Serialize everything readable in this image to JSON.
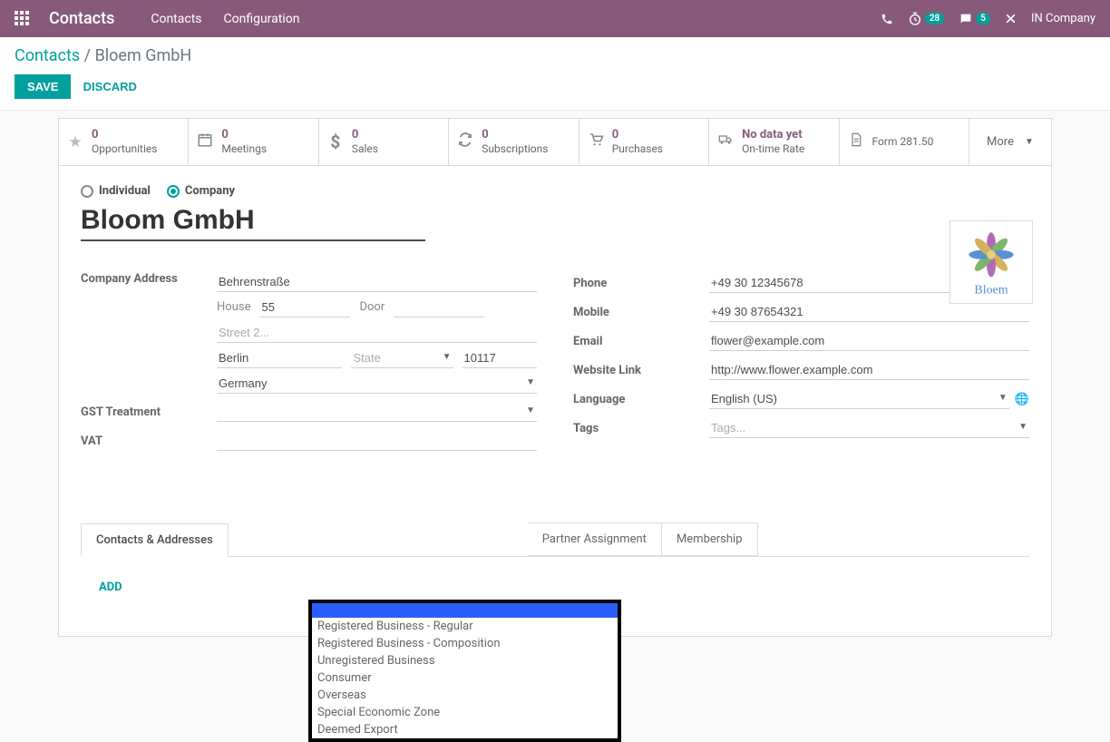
{
  "topbar": {
    "brand": "Contacts",
    "nav": {
      "contacts": "Contacts",
      "configuration": "Configuration"
    },
    "timer_badge": "28",
    "chat_badge": "5",
    "company": "IN Company"
  },
  "breadcrumb": {
    "root": "Contacts",
    "current": "Bloem GmbH"
  },
  "actions": {
    "save": "SAVE",
    "discard": "DISCARD"
  },
  "stats": {
    "opportunities": {
      "num": "0",
      "label": "Opportunities"
    },
    "meetings": {
      "num": "0",
      "label": "Meetings"
    },
    "sales": {
      "num": "0",
      "label": "Sales"
    },
    "subscriptions": {
      "num": "0",
      "label": "Subscriptions"
    },
    "purchases": {
      "num": "0",
      "label": "Purchases"
    },
    "ontime": {
      "num": "No data yet",
      "label": "On-time Rate"
    },
    "form281": "Form 281.50",
    "more": "More"
  },
  "type": {
    "individual": "Individual",
    "company": "Company"
  },
  "name": "Bloom GmbH",
  "avatar_caption": "Bloem",
  "labels": {
    "company_address": "Company Address",
    "gst": "GST Treatment",
    "vat": "VAT",
    "phone": "Phone",
    "mobile": "Mobile",
    "email": "Email",
    "website": "Website Link",
    "language": "Language",
    "tags": "Tags"
  },
  "address": {
    "street": "Behrenstraße",
    "house_label": "House",
    "house": "55",
    "door_label": "Door",
    "door": "",
    "street2_ph": "Street 2...",
    "city": "Berlin",
    "state_ph": "State",
    "zip": "10117",
    "country": "Germany"
  },
  "contact": {
    "phone": "+49 30 12345678",
    "mobile": "+49 30 87654321",
    "email": "flower@example.com",
    "website": "http://www.flower.example.com",
    "language": "English (US)",
    "tags_ph": "Tags..."
  },
  "gst_options": [
    "Registered Business - Regular",
    "Registered Business - Composition",
    "Unregistered Business",
    "Consumer",
    "Overseas",
    "Special Economic Zone",
    "Deemed Export"
  ],
  "tabs": {
    "contacts": "Contacts & Addresses",
    "partner": "Partner Assignment",
    "membership": "Membership"
  },
  "add": "ADD"
}
